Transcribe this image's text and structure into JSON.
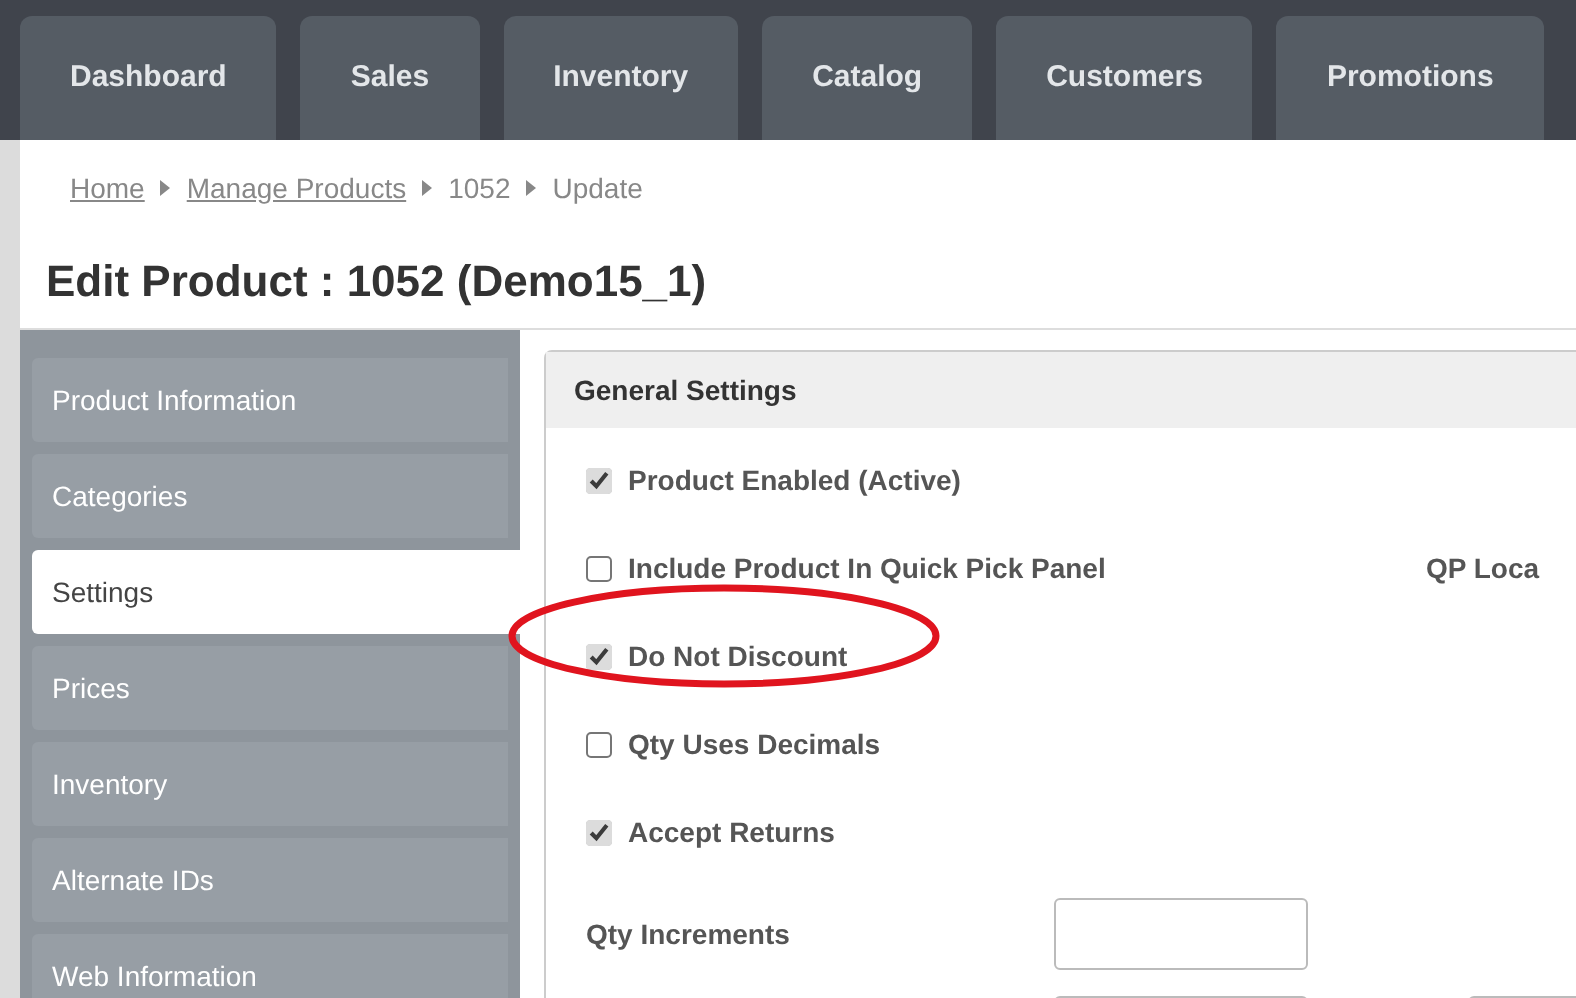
{
  "nav_tabs": [
    {
      "label": "Dashboard",
      "selected": false
    },
    {
      "label": "Sales",
      "selected": false
    },
    {
      "label": "Inventory",
      "selected": false
    },
    {
      "label": "Catalog",
      "selected": false
    },
    {
      "label": "Customers",
      "selected": false
    },
    {
      "label": "Promotions",
      "selected": false
    }
  ],
  "breadcrumb": [
    {
      "label": "Home",
      "kind": "link"
    },
    {
      "label": "Manage Products",
      "kind": "link"
    },
    {
      "label": "1052",
      "kind": "text"
    },
    {
      "label": "Update",
      "kind": "text"
    }
  ],
  "page_title": "Edit Product : 1052 (Demo15_1)",
  "sidebar": {
    "items": [
      {
        "label": "Product Information",
        "selected": false
      },
      {
        "label": "Categories",
        "selected": false
      },
      {
        "label": "Settings",
        "selected": true
      },
      {
        "label": "Prices",
        "selected": false
      },
      {
        "label": "Inventory",
        "selected": false
      },
      {
        "label": "Alternate IDs",
        "selected": false
      },
      {
        "label": "Web Information",
        "selected": false
      }
    ]
  },
  "panel": {
    "title": "General Settings",
    "rows": [
      {
        "kind": "checkbox",
        "label": "Product Enabled (Active)",
        "checked": true,
        "highlighted": false
      },
      {
        "kind": "checkbox",
        "label": "Include Product In Quick Pick Panel",
        "checked": false,
        "highlighted": false,
        "side_label": "QP Loca"
      },
      {
        "kind": "checkbox",
        "label": "Do Not Discount",
        "checked": true,
        "highlighted": true
      },
      {
        "kind": "checkbox",
        "label": "Qty Uses Decimals",
        "checked": false,
        "highlighted": false
      },
      {
        "kind": "checkbox",
        "label": "Accept Returns",
        "checked": true,
        "highlighted": false
      },
      {
        "kind": "field",
        "label": "Qty Increments"
      },
      {
        "kind": "field_pair"
      }
    ]
  }
}
